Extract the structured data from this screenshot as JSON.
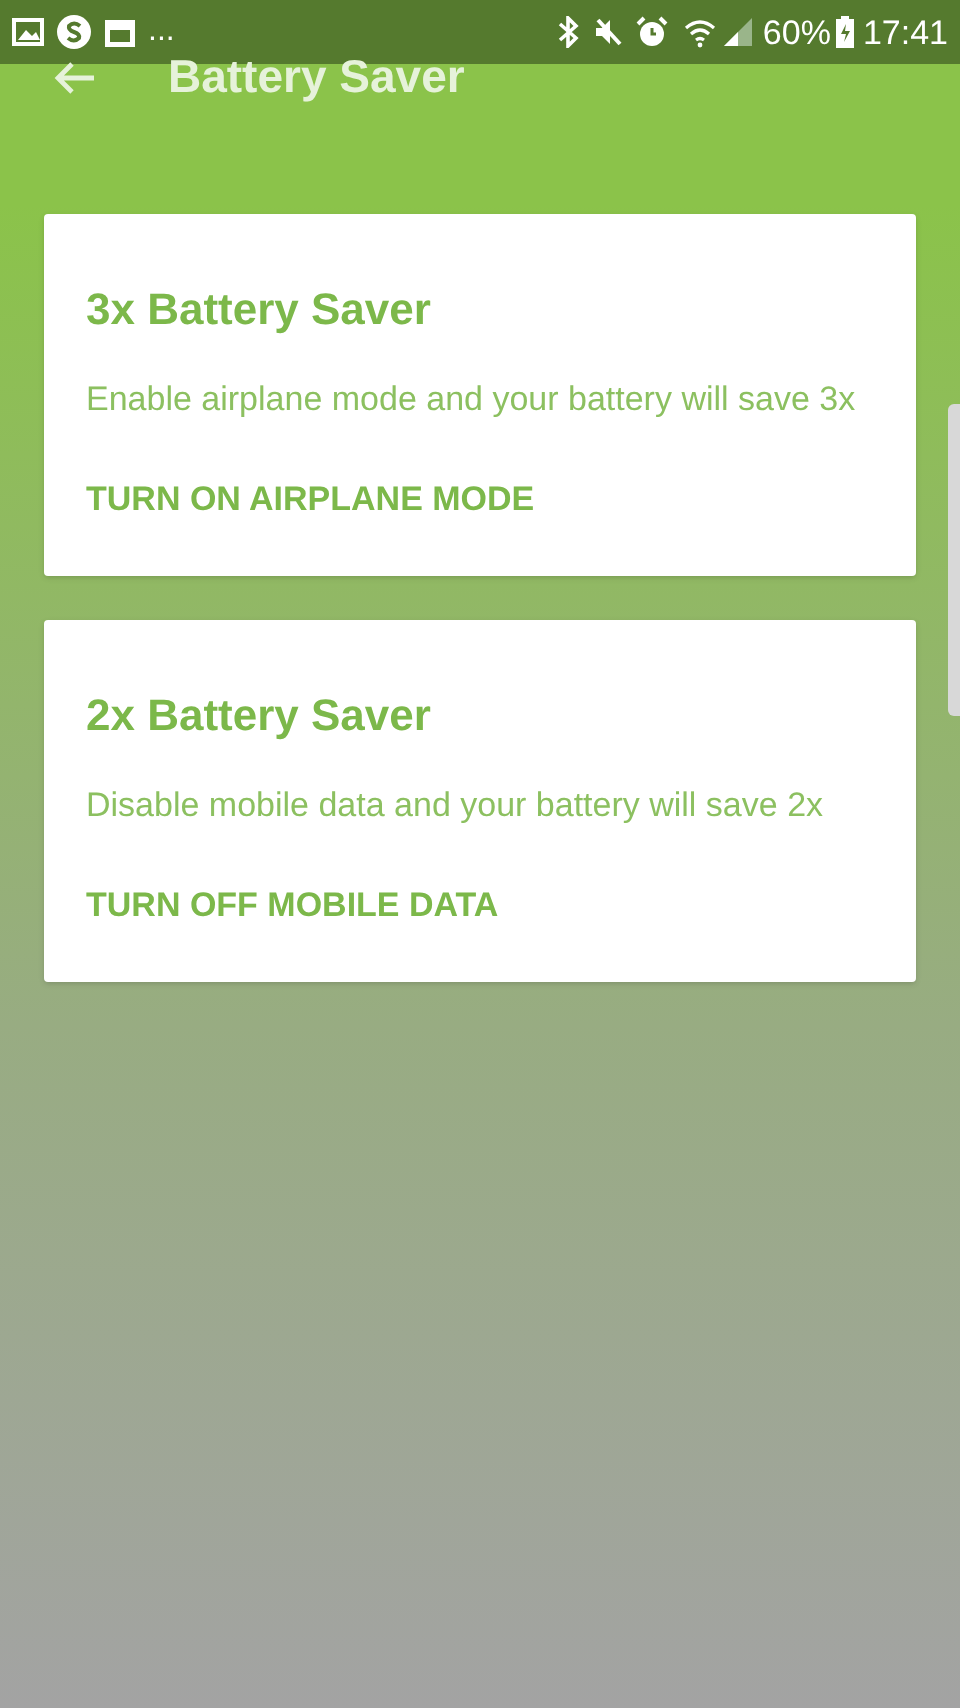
{
  "status_bar": {
    "overflow": "...",
    "battery": "60%",
    "time": "17:41"
  },
  "app_bar": {
    "title": "Battery Saver"
  },
  "cards": [
    {
      "title": "3x Battery Saver",
      "description": "Enable airplane mode and your battery will save 3x",
      "action": "TURN ON AIRPLANE MODE"
    },
    {
      "title": "2x Battery Saver",
      "description": "Disable mobile data and your battery will save 2x",
      "action": "TURN OFF MOBILE DATA"
    }
  ]
}
